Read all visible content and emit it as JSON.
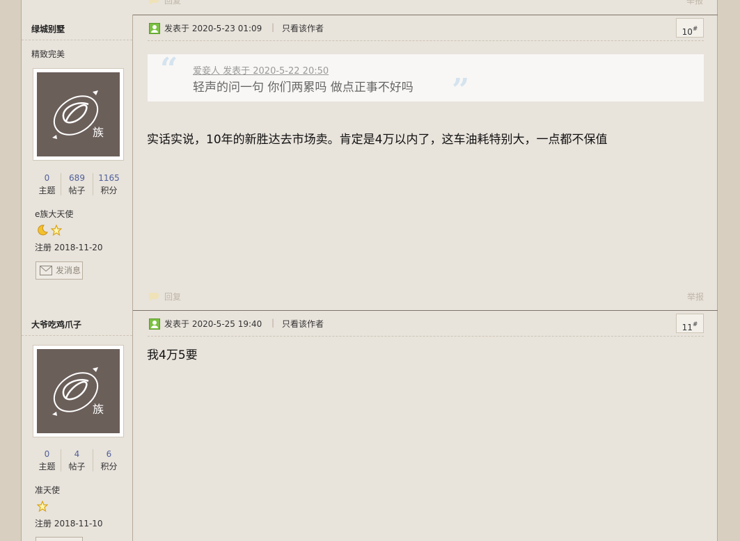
{
  "actions": {
    "reply": "回复",
    "report": "举报"
  },
  "posts": [
    {
      "author": "绿城别墅",
      "custom_status": "精致完美",
      "avatar_text": "族",
      "stats": [
        {
          "value": "0",
          "label": "主题"
        },
        {
          "value": "689",
          "label": "帖子"
        },
        {
          "value": "1165",
          "label": "积分"
        }
      ],
      "group": "e族大天使",
      "reg_date": "注册 2018-11-20",
      "message_button": "发消息",
      "posted": "发表于 2020-5-23 01:09",
      "only_author": "只看该作者",
      "floor": "10",
      "floor_sup": "#",
      "quote": {
        "meta": "爱妾人 发表于 2020-5-22 20:50",
        "text": "轻声的问一句 你们两累吗 做点正事不好吗"
      },
      "content": "实话实说，10年的新胜达去市场卖。肯定是4万以内了，这车油耗特别大，一点都不保值"
    },
    {
      "author": "大爷吃鸡爪子",
      "avatar_text": "族",
      "stats": [
        {
          "value": "0",
          "label": "主题"
        },
        {
          "value": "4",
          "label": "帖子"
        },
        {
          "value": "6",
          "label": "积分"
        }
      ],
      "group": "准天使",
      "reg_date": "注册 2018-11-10",
      "posted": "发表于 2020-5-25 19:40",
      "only_author": "只看该作者",
      "floor": "11",
      "floor_sup": "#",
      "content": "我4万5要"
    }
  ],
  "colors": {
    "page_bg": "#d8cfc0",
    "panel_bg": "#e8e3db",
    "avatar_bg": "#6b5f5a",
    "stat_num": "#4f5f9a"
  }
}
